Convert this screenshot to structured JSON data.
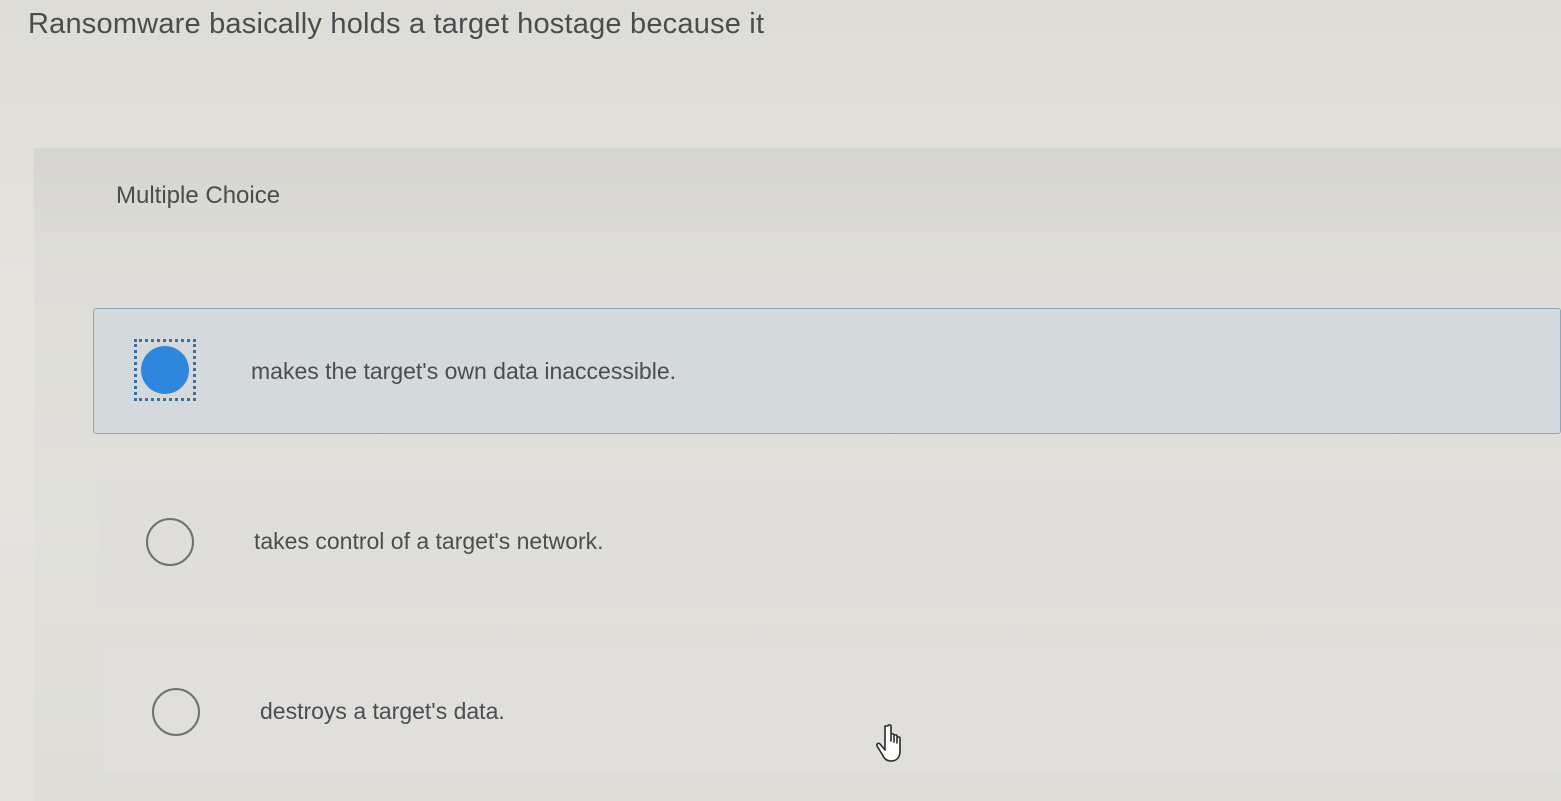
{
  "question": {
    "text": "Ransomware basically holds a target hostage because it"
  },
  "panel": {
    "label": "Multiple Choice"
  },
  "options": [
    {
      "text": "makes the target's own data inaccessible.",
      "selected": true
    },
    {
      "text": "takes control of a target's network.",
      "selected": false
    },
    {
      "text": "destroys a target's data.",
      "selected": false
    }
  ],
  "colors": {
    "selected_radio": "#2f86dd",
    "selected_border": "#8fa6b8"
  },
  "icons": {
    "cursor": "hand-pointer-icon"
  }
}
